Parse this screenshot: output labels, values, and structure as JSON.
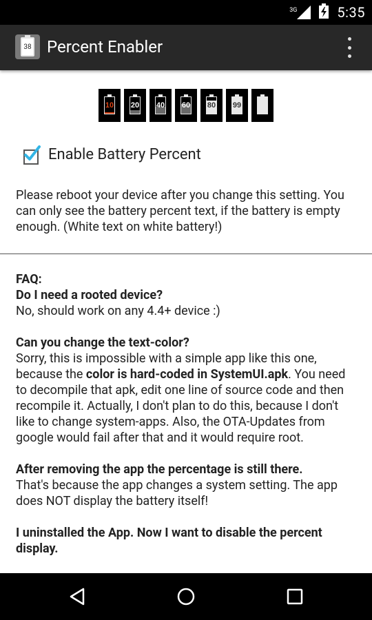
{
  "status_bar": {
    "network": "3G",
    "time": "5:35",
    "icons": [
      "signal-icon",
      "battery-charging-icon"
    ]
  },
  "app_bar": {
    "app_icon_text": "38",
    "title": "Percent Enabler",
    "overflow_icon": "overflow-menu-icon"
  },
  "battery_samples": [
    {
      "label": "10",
      "level": 10
    },
    {
      "label": "20",
      "level": 20
    },
    {
      "label": "40",
      "level": 40
    },
    {
      "label": "60",
      "level": 60
    },
    {
      "label": "80",
      "level": 80
    },
    {
      "label": "99",
      "level": 99
    },
    {
      "label": "",
      "level": 100
    }
  ],
  "setting": {
    "checkbox_label": "Enable Battery Percent",
    "checked": true
  },
  "note": "Please reboot your device after you change this setting. You can only see the battery percent text, if the battery is empty enough. (White text on white battery!)",
  "faq": {
    "heading": "FAQ:",
    "q1": "Do I need a rooted device?",
    "a1": "No, should work on any 4.4+ device :)",
    "q2": "Can you change the text-color?",
    "a2_part1": "Sorry, this is impossible with a simple app like this one, because the ",
    "a2_bold": "color is hard-coded in SystemUI.apk",
    "a2_part2": ". You need to decompile that apk, edit one line of source code and then recompile it. Actually, I don't plan to do this, because I don't like to change system-apps. Also, the OTA-Updates from google would fail after that and it would require root.",
    "q3": "After removing the app the percentage is still there.",
    "a3": "That's because the app changes a system setting. The app does NOT display the battery itself!",
    "q4": "I uninstalled the App. Now I want to disable the percent display."
  },
  "nav_bar": {
    "back_icon": "back-icon",
    "home_icon": "home-icon",
    "recents_icon": "recents-icon"
  },
  "colors": {
    "status_bar": "#000000",
    "app_bar": "#282828",
    "checkbox_check": "#33b5e5",
    "low_battery": "#d84315"
  }
}
